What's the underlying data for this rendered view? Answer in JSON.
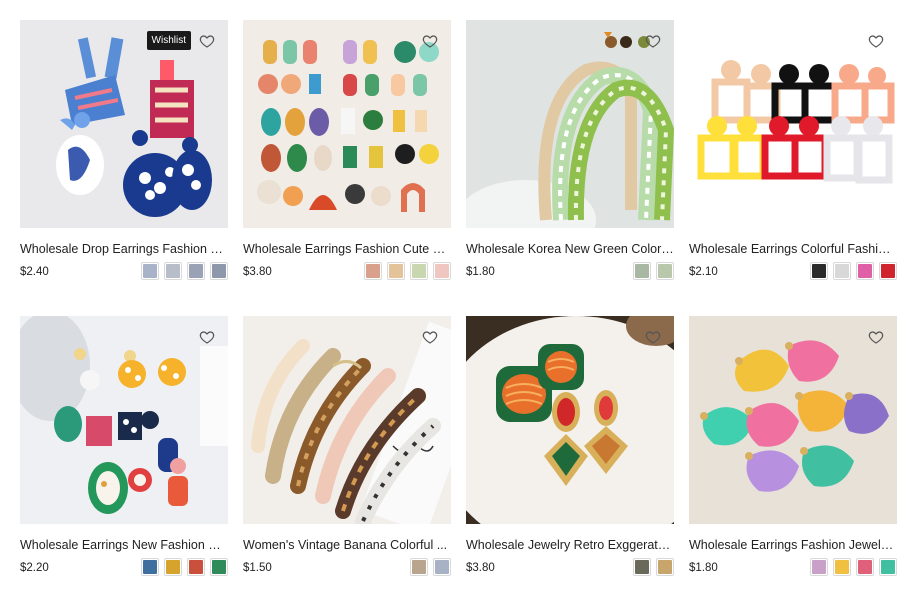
{
  "tooltip": "Wishlist",
  "products": [
    {
      "title": "Wholesale Drop Earrings Fashion C...",
      "price": "$2.40",
      "image_bg": "#e9e9eb",
      "swatch_colors": [
        "#a8b3c9",
        "#b7bdc9",
        "#9aa3b5",
        "#8e98ab"
      ]
    },
    {
      "title": "Wholesale Earrings Fashion Cute G...",
      "price": "$3.80",
      "image_bg": "#f1ece6",
      "swatch_colors": [
        "#d9a08c",
        "#e4c29a",
        "#c9d7b0",
        "#f0c7c0"
      ]
    },
    {
      "title": "Wholesale Korea New Green Colorf...",
      "price": "$1.80",
      "image_bg": "#dfe4e2",
      "swatch_colors": [
        "#a9b8a3",
        "#b9c7aa"
      ]
    },
    {
      "title": "Wholesale Earrings Colorful Fashion...",
      "price": "$2.10",
      "image_bg": "#ffffff",
      "swatch_colors": [
        "#2a2a2a",
        "#d8d8d8",
        "#e060a8",
        "#d0242e"
      ]
    },
    {
      "title": "Wholesale Earrings New Fashion Co...",
      "price": "$2.20",
      "image_bg": "#eef0f3",
      "swatch_colors": [
        "#3f6f9e",
        "#d6a32c",
        "#c9503a",
        "#2f8c5a"
      ]
    },
    {
      "title": "Women's Vintage Banana Colorful ...",
      "price": "$1.50",
      "image_bg": "#f2efea",
      "swatch_colors": [
        "#b9a58e",
        "#a7b2c4"
      ]
    },
    {
      "title": "Wholesale Jewelry Retro Exggerate...",
      "price": "$3.80",
      "image_bg": "#3a2d22",
      "swatch_colors": [
        "#6a6a5a",
        "#c7a56c"
      ]
    },
    {
      "title": "Wholesale Earrings Fashion Jewelry...",
      "price": "$1.80",
      "image_bg": "#e7e1d8",
      "swatch_colors": [
        "#c8a0c8",
        "#f0c040",
        "#e0607a",
        "#40c0a0"
      ]
    }
  ]
}
